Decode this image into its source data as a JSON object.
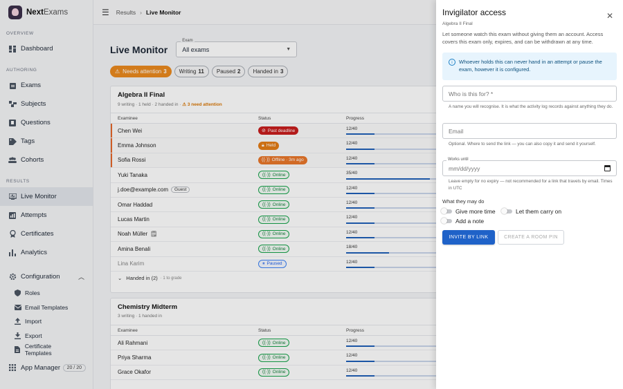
{
  "brand": {
    "name_bold": "Next",
    "name_light": "Exams"
  },
  "sidebar": {
    "sections": {
      "overview": "OVERVIEW",
      "authoring": "AUTHORING",
      "results": "RESULTS"
    },
    "dashboard": "Dashboard",
    "authoring": [
      "Exams",
      "Subjects",
      "Questions",
      "Tags",
      "Cohorts"
    ],
    "results": [
      "Live Monitor",
      "Attempts",
      "Certificates",
      "Analytics"
    ],
    "configuration": "Configuration",
    "config_items": [
      "Roles",
      "Email Templates",
      "Import",
      "Export",
      "Certificate Templates"
    ],
    "app_manager": "App Manager",
    "app_manager_count": "20 / 20"
  },
  "breadcrumb": {
    "parent": "Results",
    "current": "Live Monitor"
  },
  "page": {
    "title": "Live Monitor",
    "exam_select_label": "Exam",
    "exam_select_value": "All exams"
  },
  "filters": {
    "attention_label": "Needs attention",
    "attention_count": "3",
    "writing_label": "Writing",
    "writing_count": "11",
    "paused_label": "Paused",
    "paused_count": "2",
    "handed_label": "Handed in",
    "handed_count": "3"
  },
  "table_headers": {
    "examinee": "Examinee",
    "status": "Status",
    "progress": "Progress"
  },
  "exam1": {
    "title": "Algebra II Final",
    "summary": "9 writing · 1 held · 2 handed in ·",
    "attention": "3 need attention",
    "rows": [
      {
        "name": "Chen Wei",
        "status": "Past deadline",
        "progress": "12/40",
        "fraction": 0.3
      },
      {
        "name": "Emma Johnson",
        "status": "Held",
        "progress": "12/40",
        "fraction": 0.3
      },
      {
        "name": "Sofia Rossi",
        "status": "Offline · 3m ago",
        "progress": "12/40",
        "fraction": 0.3
      },
      {
        "name": "Yuki Tanaka",
        "status": "Online",
        "progress": "35/40",
        "fraction": 0.875
      },
      {
        "name": "j.doe@example.com",
        "tag": "Guest",
        "status": "Online",
        "progress": "12/40",
        "fraction": 0.3
      },
      {
        "name": "Omar Haddad",
        "status": "Online",
        "progress": "12/40",
        "fraction": 0.3
      },
      {
        "name": "Lucas Martin",
        "status": "Online",
        "progress": "12/40",
        "fraction": 0.3
      },
      {
        "name": "Noah Müller",
        "status": "Online",
        "progress": "12/40",
        "fraction": 0.3
      },
      {
        "name": "Amina Benali",
        "status": "Online",
        "progress": "18/40",
        "fraction": 0.45
      },
      {
        "name": "Lina Karim",
        "status": "Paused",
        "progress": "12/40",
        "fraction": 0.3
      }
    ],
    "handed_label": "Handed in (2)",
    "handed_note": "· 1 to grade"
  },
  "exam2": {
    "title": "Chemistry Midterm",
    "summary": "3 writing · 1 handed in",
    "rows": [
      {
        "name": "Ali Rahmani",
        "status": "Online",
        "progress": "12/40",
        "fraction": 0.3
      },
      {
        "name": "Priya Sharma",
        "status": "Online",
        "progress": "12/40",
        "fraction": 0.3
      },
      {
        "name": "Grace Okafor",
        "status": "Online",
        "progress": "12/40",
        "fraction": 0.3
      }
    ]
  },
  "drawer": {
    "title": "Invigilator access",
    "subtitle": "Algebra II Final",
    "description": "Let someone watch this exam without giving them an account. Access covers this exam only, expires, and can be withdrawn at any time.",
    "info": "Whoever holds this can never hand in an attempt or pause the exam, however it is configured.",
    "who_placeholder": "Who is this for? *",
    "who_helper": "A name you will recognise. It is what the activity log records against anything they do.",
    "email_placeholder": "Email",
    "email_helper": "Optional. Where to send the link — you can also copy it and send it yourself.",
    "works_until_label": "Works until",
    "works_until_placeholder": "mm/dd/yyyy",
    "works_until_helper": "Leave empty for no expiry — not recommended for a link that travels by email. Times in UTC",
    "permissions_title": "What they may do",
    "perm_more_time": "Give more time",
    "perm_carry_on": "Let them carry on",
    "perm_note": "Add a note",
    "invite_button": "INVITE BY LINK",
    "pin_button": "CREATE A ROOM PIN"
  }
}
